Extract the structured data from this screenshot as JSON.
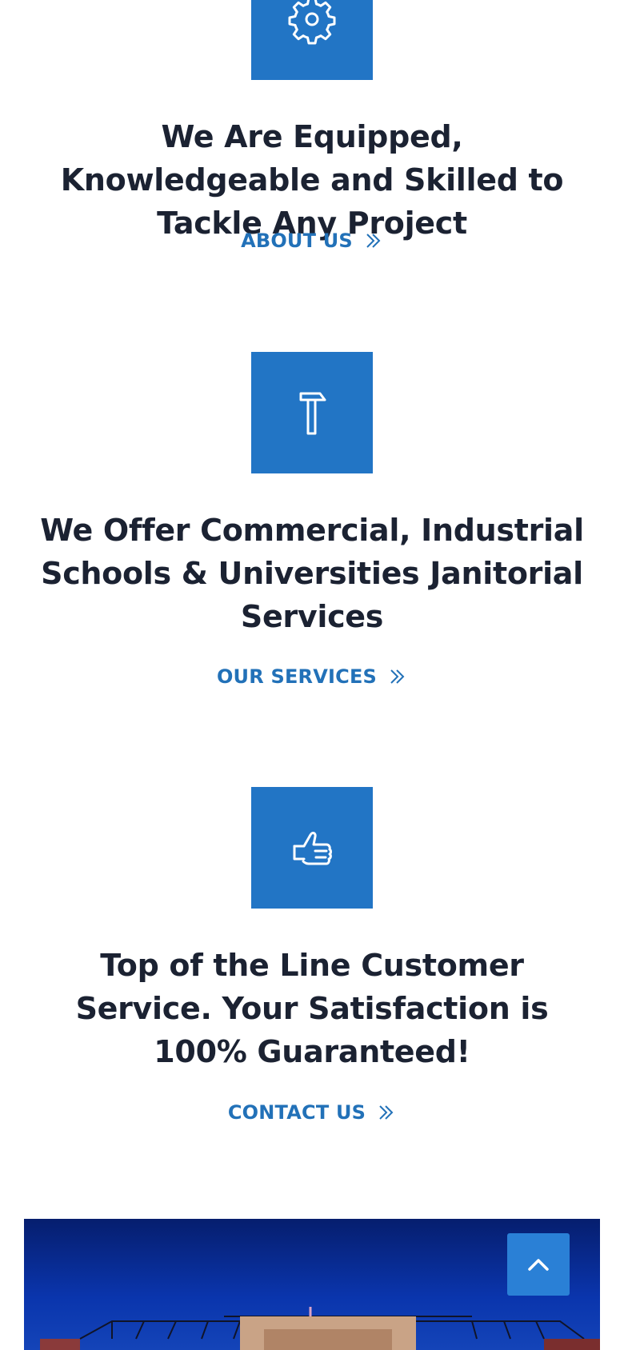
{
  "features": [
    {
      "icon": "gear-icon",
      "heading": "We Are Equipped, Knowledgeable and Skilled to Tackle Any Project",
      "link_label": "ABOUT US"
    },
    {
      "icon": "hammer-icon",
      "heading": "We Offer Commercial, Industrial Schools & Universities Janitorial Services",
      "link_label": "OUR SERVICES"
    },
    {
      "icon": "thumbs-up-icon",
      "heading": "Top of the Line Customer Service. Your Satisfaction is 100% Guaranteed!",
      "link_label": "CONTACT US"
    }
  ],
  "link_icon": "double-chevron-right-icon",
  "banner": {
    "image": "building-at-dusk-photo"
  },
  "scroll_top": {
    "icon": "chevron-up-icon"
  },
  "colors": {
    "accent": "#2275c5",
    "link": "#2271b8",
    "heading": "#1b2232",
    "banner_sky": "#0a38b0"
  }
}
